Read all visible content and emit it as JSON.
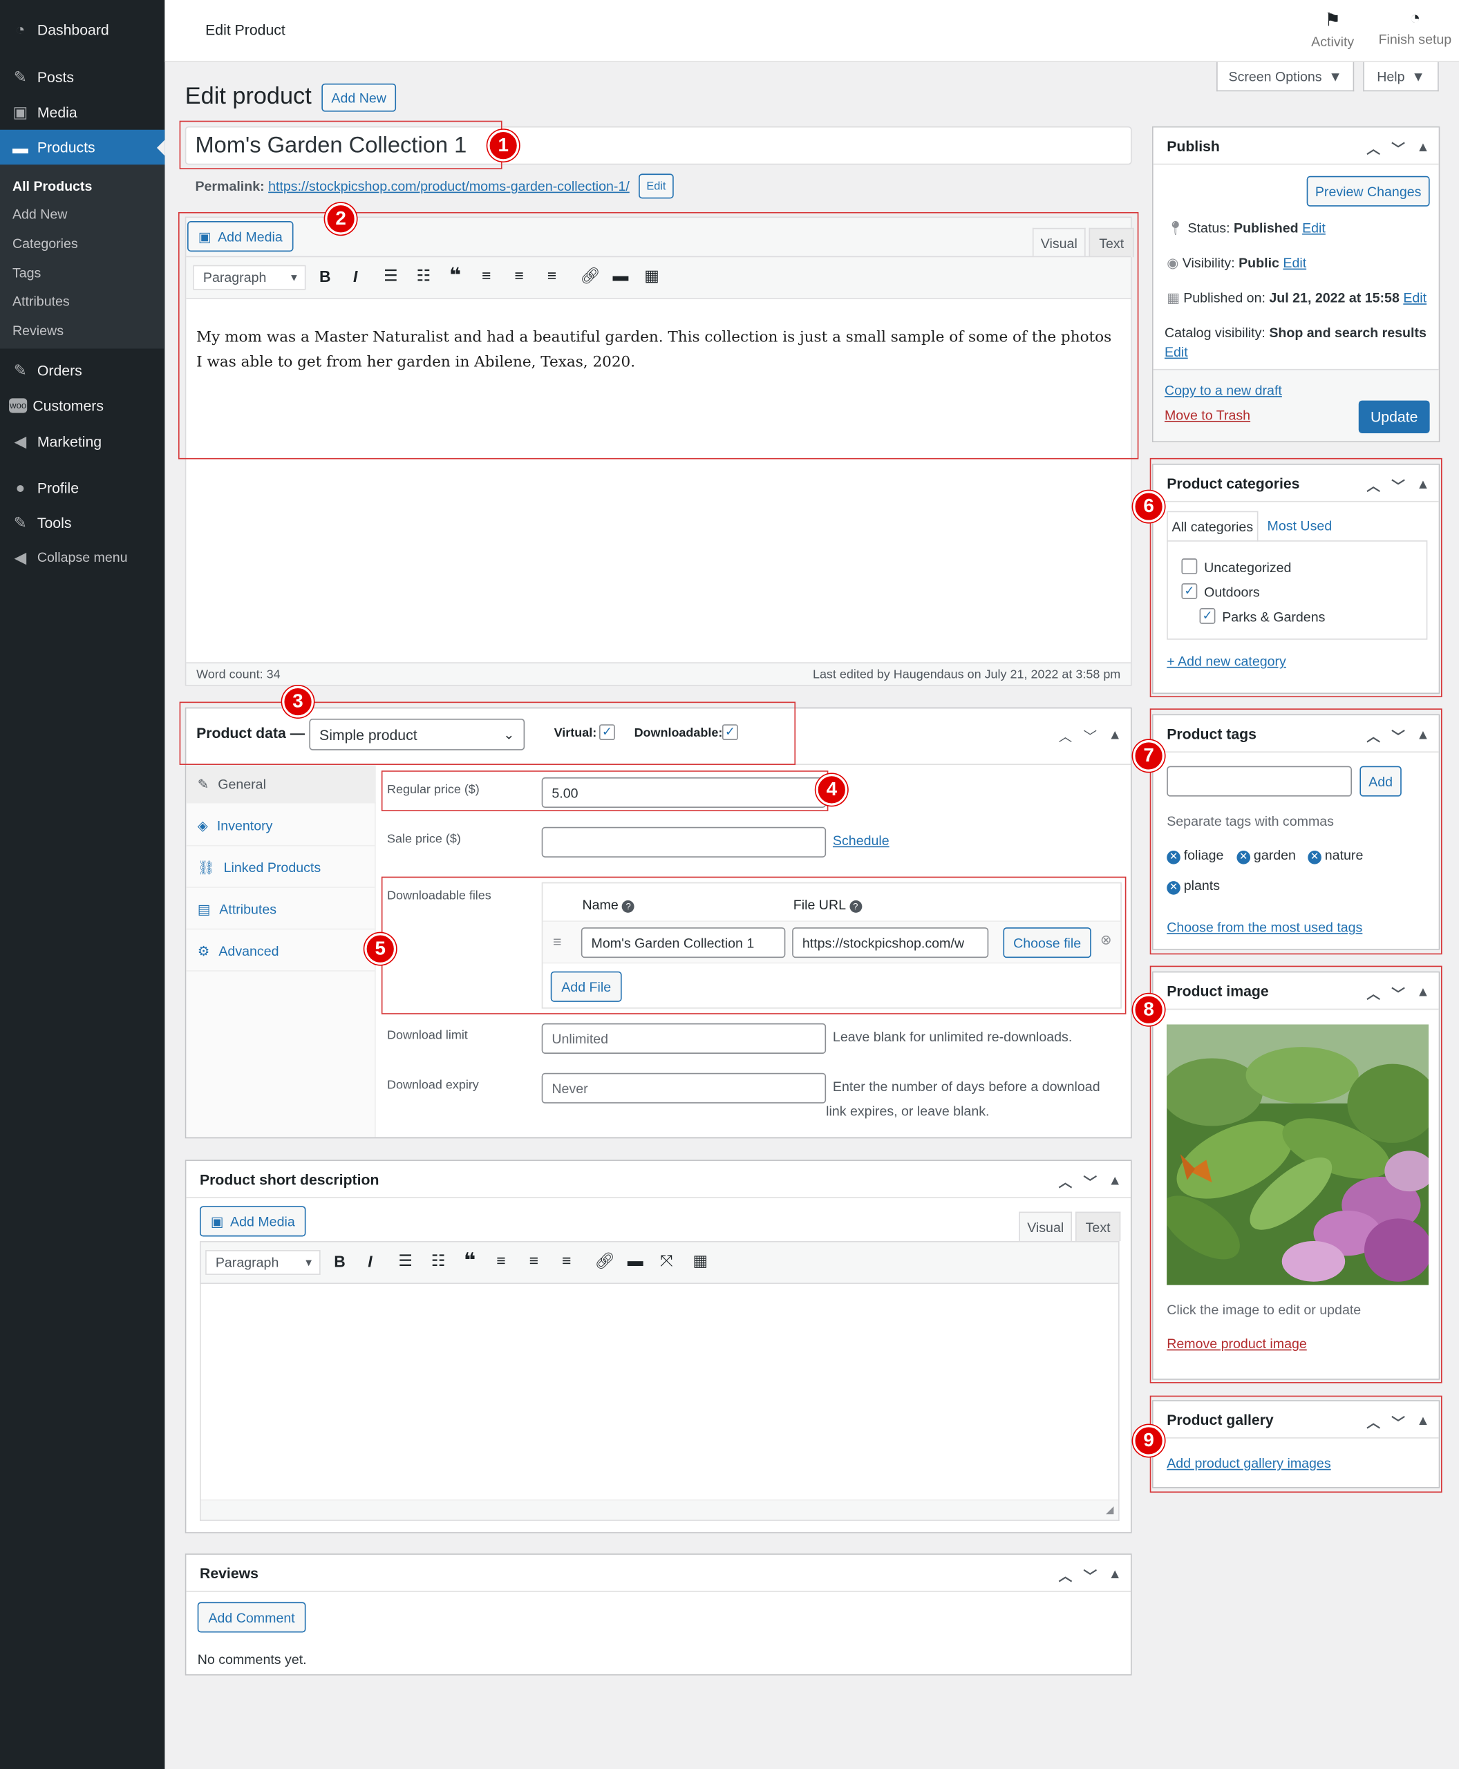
{
  "sidebar": {
    "items": [
      {
        "label": "Dashboard"
      },
      {
        "label": "Posts"
      },
      {
        "label": "Media"
      },
      {
        "label": "Products"
      },
      {
        "label": "Orders"
      },
      {
        "label": "Customers"
      },
      {
        "label": "Marketing"
      },
      {
        "label": "Profile"
      },
      {
        "label": "Tools"
      },
      {
        "label": "Collapse menu"
      }
    ],
    "submenu": [
      "All Products",
      "Add New",
      "Categories",
      "Tags",
      "Attributes",
      "Reviews"
    ]
  },
  "topbar": {
    "title": "Edit Product",
    "activity": "Activity",
    "finish_setup": "Finish setup"
  },
  "screen_options": "Screen Options",
  "help": "Help",
  "heading": {
    "title": "Edit product",
    "add_new": "Add New"
  },
  "product_title": "Mom's Garden Collection 1",
  "permalink": {
    "label": "Permalink:",
    "url": "https://stockpicshop.com/product/moms-garden-collection-1/",
    "edit": "Edit"
  },
  "editor": {
    "add_media": "Add Media",
    "tab_visual": "Visual",
    "tab_text": "Text",
    "format": "Paragraph",
    "content": "My mom was a Master Naturalist and had a beautiful garden. This collection is just a small sample of some of the photos I was able to get from her garden in Abilene, Texas, 2020.",
    "word_count": "Word count: 34",
    "last_edited": "Last edited by Haugendaus on July 21, 2022 at 3:58 pm"
  },
  "product_data": {
    "label": "Product data —",
    "type": "Simple product",
    "virtual": "Virtual:",
    "downloadable": "Downloadable:",
    "tabs": [
      "General",
      "Inventory",
      "Linked Products",
      "Attributes",
      "Advanced"
    ],
    "regular_price_label": "Regular price ($)",
    "regular_price": "5.00",
    "sale_price_label": "Sale price ($)",
    "sale_price": "",
    "schedule": "Schedule",
    "downloadable_files_label": "Downloadable files",
    "col_name": "Name",
    "col_url": "File URL",
    "file_name": "Mom's Garden Collection 1",
    "file_url": "https://stockpicshop.com/w",
    "choose_file": "Choose file",
    "add_file": "Add File",
    "download_limit_label": "Download limit",
    "download_limit_placeholder": "Unlimited",
    "download_limit_help": "Leave blank for unlimited re-downloads.",
    "download_expiry_label": "Download expiry",
    "download_expiry_placeholder": "Never",
    "download_expiry_help_1": "Enter the number of days before a download",
    "download_expiry_help_2": "link expires, or leave blank."
  },
  "short_description": {
    "title": "Product short description",
    "add_media": "Add Media",
    "tab_visual": "Visual",
    "tab_text": "Text",
    "format": "Paragraph"
  },
  "reviews": {
    "title": "Reviews",
    "add_comment": "Add Comment",
    "empty": "No comments yet."
  },
  "publish": {
    "title": "Publish",
    "preview": "Preview Changes",
    "status_label": "Status:",
    "status": "Published",
    "visibility_label": "Visibility:",
    "visibility": "Public",
    "published_label": "Published on:",
    "published": "Jul 21, 2022 at 15:58",
    "catalog_label": "Catalog visibility:",
    "catalog": "Shop and search results",
    "edit": "Edit",
    "copy_draft": "Copy to a new draft",
    "trash": "Move to Trash",
    "update": "Update"
  },
  "categories": {
    "title": "Product categories",
    "tab_all": "All categories",
    "tab_most": "Most Used",
    "items": [
      {
        "label": "Uncategorized",
        "checked": false
      },
      {
        "label": "Outdoors",
        "checked": true
      },
      {
        "label": "Parks & Gardens",
        "checked": true
      }
    ],
    "add_new": "+ Add new category"
  },
  "tags": {
    "title": "Product tags",
    "add": "Add",
    "help": "Separate tags with commas",
    "items": [
      "foliage",
      "garden",
      "nature",
      "plants"
    ],
    "choose": "Choose from the most used tags"
  },
  "product_image": {
    "title": "Product image",
    "help": "Click the image to edit or update",
    "remove": "Remove product image"
  },
  "gallery": {
    "title": "Product gallery",
    "add": "Add product gallery images"
  },
  "annotations": [
    "1",
    "2",
    "3",
    "4",
    "5",
    "6",
    "7",
    "8",
    "9"
  ],
  "colors": {
    "accent": "#2271b1",
    "annotation": "#e00000",
    "sidebar": "#1d2327"
  }
}
